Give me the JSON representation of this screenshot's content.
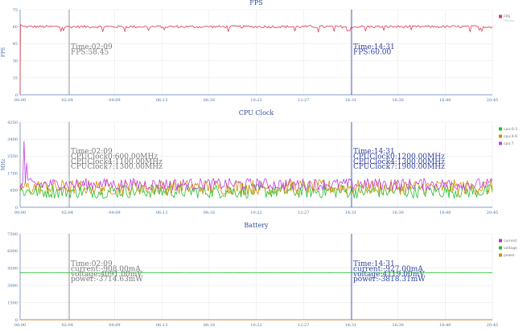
{
  "chart_data": [
    {
      "type": "line",
      "title": "FPS",
      "ylabel": "FPS",
      "ylim": [
        0,
        75
      ],
      "yticks": [
        "0",
        "15",
        "30",
        "45",
        "60",
        "75"
      ],
      "xticks": [
        "00:00",
        "02:04",
        "04:09",
        "06:13",
        "08:18",
        "10:22",
        "12:27",
        "14:31",
        "16:36",
        "18:40",
        "20:45"
      ],
      "grid": true,
      "legend_position": "right",
      "series": [
        {
          "name": "FPS",
          "color": "#e0405a",
          "base": 60,
          "noise": 1.2,
          "dips": 0.04,
          "dip_depth": 4,
          "sample_count": 360,
          "start": [
            [
              0,
              0
            ],
            [
              0.03,
              62
            ]
          ]
        }
      ],
      "legend_extra": "FPS(Hz)",
      "cursors": [
        {
          "position_time": "02:09",
          "color": "#888888",
          "lines": [
            "Time:02:09",
            "FPS:58.45"
          ]
        },
        {
          "position_time": "14:31",
          "color": "#3a4fbf",
          "lines": [
            "Time:14:31",
            "FPS:60.00"
          ]
        }
      ]
    },
    {
      "type": "line",
      "title": "CPU Clock",
      "ylabel": "MHz",
      "ylim": [
        0,
        4250
      ],
      "yticks": [
        "0",
        "850",
        "1700",
        "2550",
        "3400",
        "4250"
      ],
      "xticks": [
        "00:00",
        "02:04",
        "04:09",
        "06:13",
        "08:18",
        "10:22",
        "12:27",
        "14:31",
        "16:36",
        "18:40",
        "20:45"
      ],
      "grid": true,
      "legend_position": "right",
      "series": [
        {
          "name": "cpu:0-3",
          "color": "#22c02a",
          "base": 800,
          "noise": 350,
          "sample_count": 360
        },
        {
          "name": "cpu:4-6",
          "color": "#d09000",
          "base": 1000,
          "noise": 380,
          "sample_count": 360
        },
        {
          "name": "cpu:7",
          "color": "#c040e0",
          "base": 1150,
          "noise": 300,
          "spike": 3300,
          "sample_count": 360
        }
      ],
      "cursors": [
        {
          "position_time": "02:09",
          "color": "#888888",
          "lines": [
            "Time:02:09",
            "CPUClock0:600.00MHz",
            "CPUClock4:1100.00MHz",
            "CPUClock7:1300.00MHz"
          ]
        },
        {
          "position_time": "14:31",
          "color": "#3a4fbf",
          "lines": [
            "Time:14:31",
            "CPUClock0:1200.00MHz",
            "CPUClock4:1300.00MHz",
            "CPUClock7:1900.00MHz"
          ]
        }
      ]
    },
    {
      "type": "line",
      "title": "Battery",
      "ylabel": "",
      "ylim": [
        0,
        7500
      ],
      "yticks": [
        "0",
        "1500",
        "3000",
        "4500",
        "6000",
        "7500"
      ],
      "xticks": [
        "00:00",
        "02:04",
        "04:09",
        "06:13",
        "08:18",
        "10:22",
        "12:27",
        "14:31",
        "16:36",
        "18:40",
        "20:45"
      ],
      "grid": true,
      "legend_position": "right",
      "series": [
        {
          "name": "current",
          "color": "#c030c0",
          "base": 0,
          "noise": 0,
          "sample_count": 2
        },
        {
          "name": "voltage",
          "color": "#22c02a",
          "base": 4110,
          "noise": 8,
          "sample_count": 120
        },
        {
          "name": "power",
          "color": "#d09000",
          "base": 0,
          "noise": 0,
          "sample_count": 2
        }
      ],
      "cursors": [
        {
          "position_time": "02:09",
          "color": "#888888",
          "lines": [
            "Time:02:09",
            "current:-908.00mA",
            "voltage:4091.00mV",
            "power:-3714.63mW"
          ]
        },
        {
          "position_time": "14:31",
          "color": "#3a4fbf",
          "lines": [
            "Time:14:31",
            "current:-927.00mA",
            "voltage:4119.00mV",
            "power:-3818.31mW"
          ]
        }
      ]
    }
  ]
}
